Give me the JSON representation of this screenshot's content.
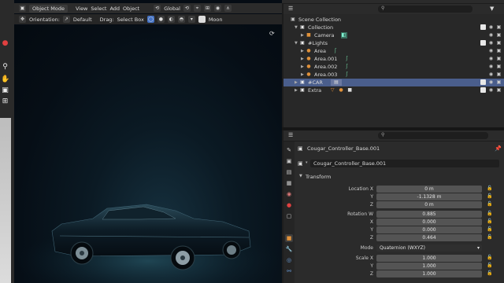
{
  "viewport": {
    "mode": "Object Mode",
    "menus": [
      "View",
      "Select",
      "Add",
      "Object"
    ],
    "transform_space": "Global",
    "orientation_label": "Orientation:",
    "orientation_value": "Default",
    "drag_label": "Drag:",
    "drag_value": "Select Box",
    "world": "Moon"
  },
  "outliner": {
    "title": "Scene Collection",
    "rows": [
      {
        "label": "Collection",
        "depth": 1,
        "icon": "collection-icon"
      },
      {
        "label": "Camera",
        "depth": 2,
        "icon": "camera-icon"
      },
      {
        "label": "#Lights",
        "depth": 1,
        "icon": "collection-icon"
      },
      {
        "label": "Area",
        "depth": 2,
        "icon": "light-icon"
      },
      {
        "label": "Area.001",
        "depth": 2,
        "icon": "light-icon"
      },
      {
        "label": "Area.002",
        "depth": 2,
        "icon": "light-icon"
      },
      {
        "label": "Area.003",
        "depth": 2,
        "icon": "light-icon"
      },
      {
        "label": "#CAR",
        "depth": 1,
        "icon": "collection-icon",
        "selected": true
      },
      {
        "label": "Extra",
        "depth": 1,
        "icon": "collection-icon"
      }
    ]
  },
  "properties": {
    "object_name": "Cougar_Controller_Base.001",
    "object_name_field": "Cougar_Controller_Base.001",
    "section": "Transform",
    "location": {
      "label": "Location X",
      "x": "0 m",
      "y": "-1.1328 m",
      "z": "0 m"
    },
    "rotation": {
      "label": "Rotation W",
      "w": "0.885",
      "x": "0.000",
      "y": "0.000",
      "z": "0.464"
    },
    "mode_label": "Mode",
    "mode_value": "Quaternion (WXYZ)",
    "scale": {
      "label": "Scale X",
      "x": "1.000",
      "y": "1.000",
      "z": "1.000"
    },
    "axis": {
      "x": "X",
      "y": "Y",
      "z": "Z"
    }
  }
}
